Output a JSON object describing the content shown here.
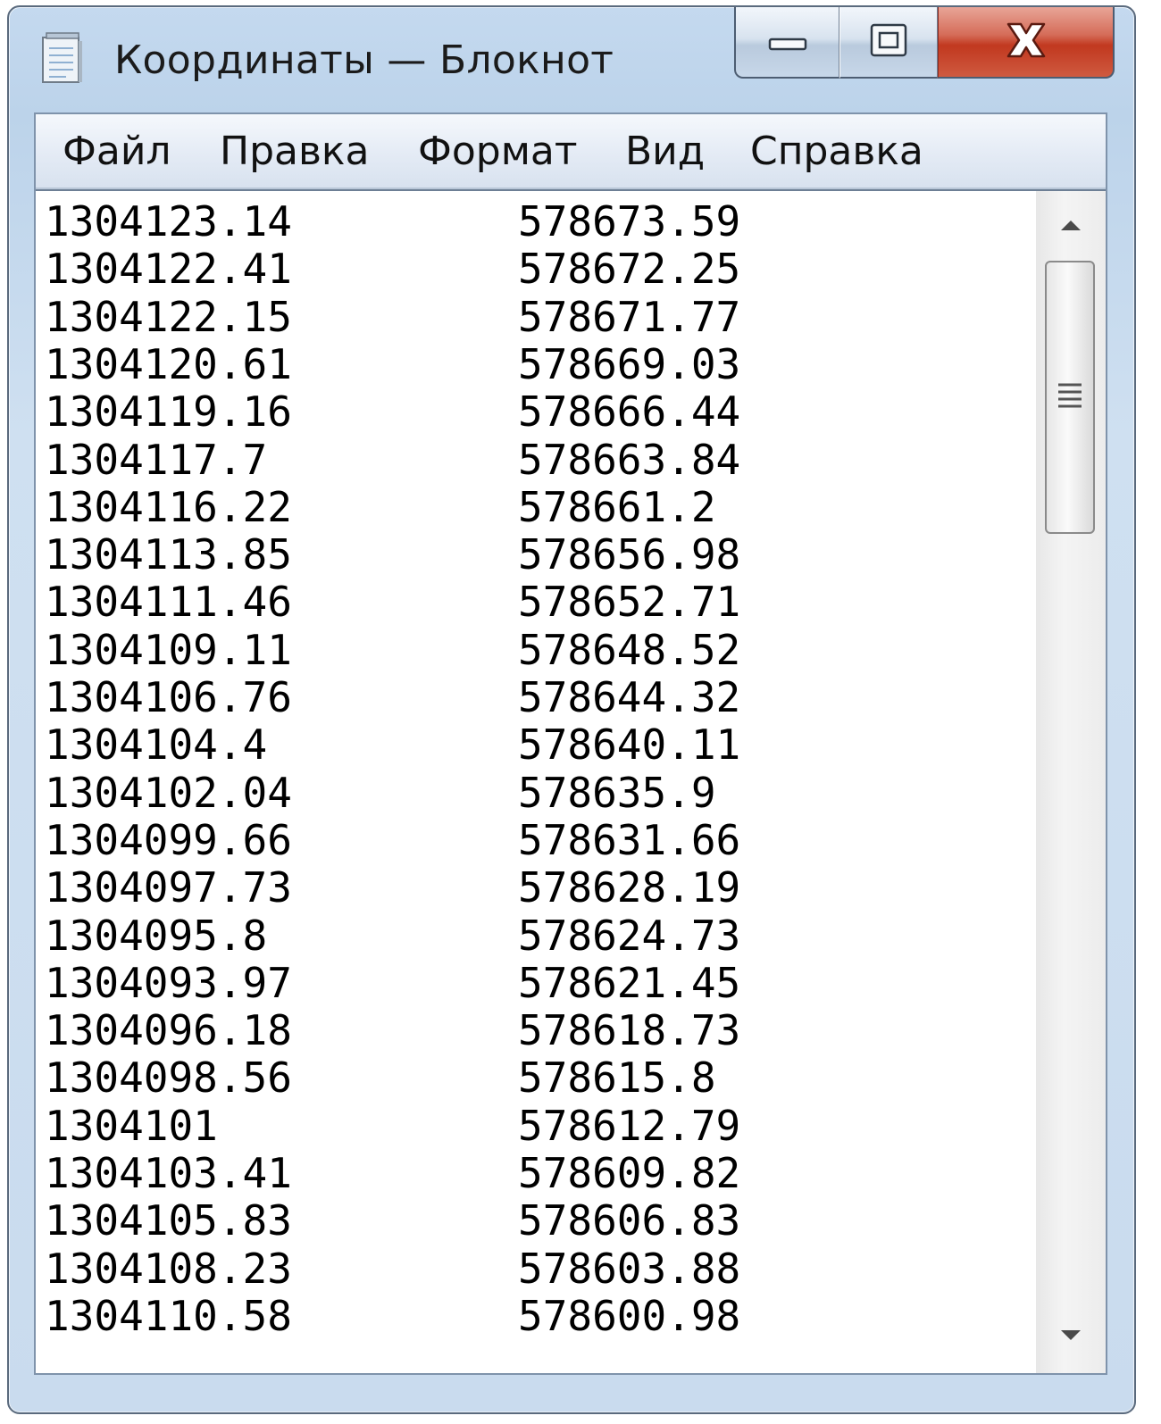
{
  "window": {
    "title": "Координаты — Блокнот"
  },
  "menu": {
    "file": "Файл",
    "edit": "Правка",
    "format": "Формат",
    "view": "Вид",
    "help": "Справка"
  },
  "document": {
    "rows": [
      {
        "x": "1304123.14",
        "y": "578673.59"
      },
      {
        "x": "1304122.41",
        "y": "578672.25"
      },
      {
        "x": "1304122.15",
        "y": "578671.77"
      },
      {
        "x": "1304120.61",
        "y": "578669.03"
      },
      {
        "x": "1304119.16",
        "y": "578666.44"
      },
      {
        "x": "1304117.7",
        "y": "578663.84"
      },
      {
        "x": "1304116.22",
        "y": "578661.2"
      },
      {
        "x": "1304113.85",
        "y": "578656.98"
      },
      {
        "x": "1304111.46",
        "y": "578652.71"
      },
      {
        "x": "1304109.11",
        "y": "578648.52"
      },
      {
        "x": "1304106.76",
        "y": "578644.32"
      },
      {
        "x": "1304104.4",
        "y": "578640.11"
      },
      {
        "x": "1304102.04",
        "y": "578635.9"
      },
      {
        "x": "1304099.66",
        "y": "578631.66"
      },
      {
        "x": "1304097.73",
        "y": "578628.19"
      },
      {
        "x": "1304095.8",
        "y": "578624.73"
      },
      {
        "x": "1304093.97",
        "y": "578621.45"
      },
      {
        "x": "1304096.18",
        "y": "578618.73"
      },
      {
        "x": "1304098.56",
        "y": "578615.8"
      },
      {
        "x": "1304101",
        "y": "578612.79"
      },
      {
        "x": "1304103.41",
        "y": "578609.82"
      },
      {
        "x": "1304105.83",
        "y": "578606.83"
      },
      {
        "x": "1304108.23",
        "y": "578603.88"
      },
      {
        "x": "1304110.58",
        "y": "578600.98"
      }
    ]
  },
  "icons": {
    "app": "notepad-icon",
    "minimize": "minimize-icon",
    "maximize": "maximize-icon",
    "close": "close-icon",
    "scroll_up": "arrow-up-icon",
    "scroll_down": "arrow-down-icon",
    "grip": "grip-icon"
  },
  "colors": {
    "frame": "#c4d9ef",
    "close_button": "#c1381f",
    "text": "#000000"
  }
}
